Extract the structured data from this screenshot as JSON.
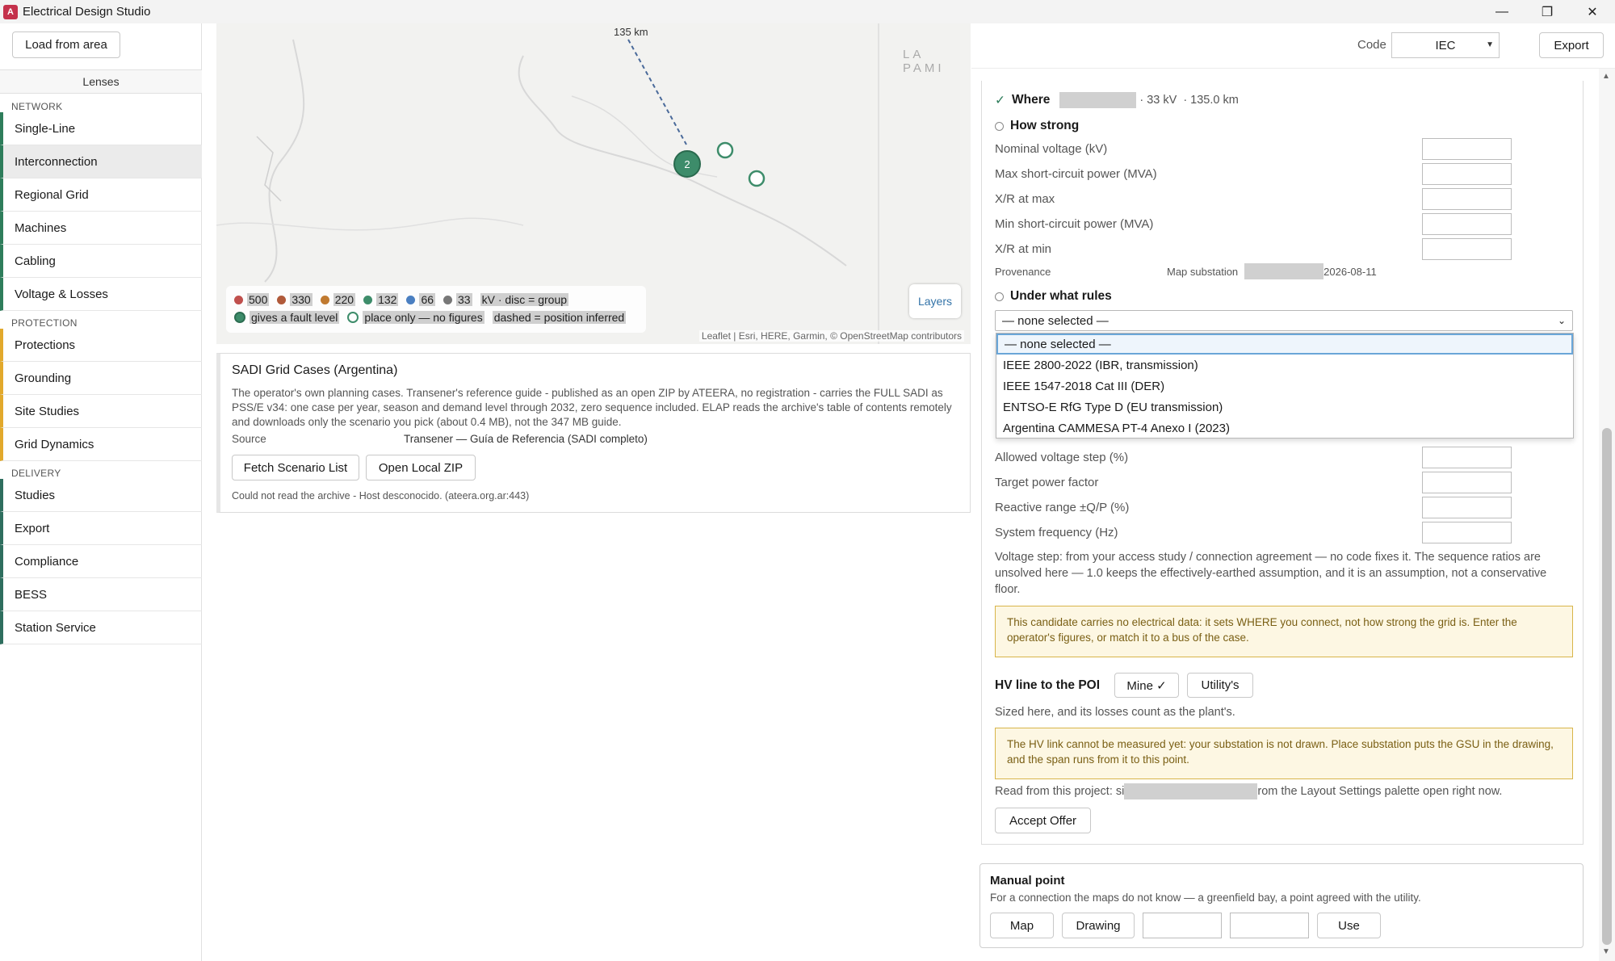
{
  "app": {
    "title": "Electrical Design Studio",
    "icon": "A"
  },
  "window": {
    "minimize": "—",
    "restore": "❐",
    "close": "✕"
  },
  "sidebar": {
    "load_button": "Load from area",
    "lenses_label": "Lenses",
    "groups": [
      {
        "label": "NETWORK",
        "items": [
          "Single-Line",
          "Interconnection",
          "Regional Grid",
          "Machines",
          "Cabling",
          "Voltage & Losses"
        ]
      },
      {
        "label": "PROTECTION",
        "items": [
          "Protections",
          "Grounding",
          "Site Studies",
          "Grid Dynamics"
        ]
      },
      {
        "label": "DELIVERY",
        "items": [
          "Studies",
          "Export",
          "Compliance",
          "BESS",
          "Station Service"
        ]
      }
    ],
    "active_item": "Interconnection"
  },
  "map": {
    "distance_label": "135 km",
    "region_label": "LA PAMI",
    "cluster_count": "2",
    "legend": {
      "voltages": [
        {
          "label": "500",
          "color": "#c0504d"
        },
        {
          "label": "330",
          "color": "#b05a3a"
        },
        {
          "label": "220",
          "color": "#c07a30"
        },
        {
          "label": "132",
          "color": "#3d8c6a"
        },
        {
          "label": "66",
          "color": "#4a7fc1"
        },
        {
          "label": "33",
          "color": "#777777"
        }
      ],
      "unit_note": "kV · disc = group",
      "fault_level": "gives a fault level",
      "place_only": "place only — no figures",
      "dashed": "dashed = position inferred"
    },
    "layers_button": "Layers",
    "attribution": "Leaflet | Esri, HERE, Garmin, © OpenStreetMap contributors"
  },
  "sadi": {
    "title": "SADI Grid Cases (Argentina)",
    "description": "The operator's own planning cases. Transener's reference guide - published as an open ZIP by ATEERA, no registration - carries the FULL SADI as PSS/E v34: one case per year, season and demand level through 2032, zero sequence included. ELAP reads the archive's table of contents remotely and downloads only the scenario you pick (about 0.4 MB), not the 347 MB guide.",
    "source_label": "Source",
    "source_value": "Transener — Guía de Referencia (SADI completo)",
    "fetch_button": "Fetch Scenario List",
    "open_button": "Open Local ZIP",
    "error": "Could not read the archive - Host desconocido. (ateera.org.ar:443)"
  },
  "toolbar": {
    "code_label": "Code",
    "code_value": "IEC",
    "export_button": "Export"
  },
  "where": {
    "label": "Where",
    "voltage": "· 33 kV",
    "distance": "· 135.0 km"
  },
  "how_strong": {
    "label": "How strong",
    "fields": [
      "Nominal voltage (kV)",
      "Max short-circuit power (MVA)",
      "X/R at max",
      "Min short-circuit power (MVA)",
      "X/R at min"
    ],
    "provenance_label": "Provenance",
    "provenance_source": "Map substation",
    "provenance_date": "2026-08-11"
  },
  "rules": {
    "label": "Under what rules",
    "selected": "— none selected —",
    "options": [
      "— none selected —",
      "IEEE 2800-2022 (IBR, transmission)",
      "IEEE 1547-2018 Cat III (DER)",
      "ENTSO-E RfG Type D (EU transmission)",
      "Argentina CAMMESA PT-4 Anexo I (2023)"
    ]
  },
  "rule_fields": [
    "Allowed voltage step (%)",
    "Target power factor",
    "Reactive range ±Q/P (%)",
    "System frequency (Hz)"
  ],
  "voltage_note": "Voltage step: from your access study / connection agreement — no code fixes it. The sequence ratios are unsolved here — 1.0 keeps the effectively-earthed assumption, and it is an assumption, not a conservative floor.",
  "warn_candidate": "This candidate carries no electrical data: it sets WHERE you connect, not how strong the grid is. Enter the operator's figures, or match it to a bus of the case.",
  "hv": {
    "title": "HV line to the POI",
    "mine_button": "Mine ✓",
    "utility_button": "Utility's",
    "sized_note": "Sized here, and its losses count as the plant's.",
    "warn": "The HV link cannot be measured yet: your substation is not drawn. Place substation puts the GSU in the drawing, and the span runs from it to this point.",
    "read_prefix": "Read from this project: si",
    "read_suffix": "rom the Layout Settings palette open right now.",
    "accept_button": "Accept Offer"
  },
  "manual": {
    "title": "Manual point",
    "description": "For a connection the maps do not know — a greenfield bay, a point agreed with the utility.",
    "map_button": "Map",
    "drawing_button": "Drawing",
    "use_button": "Use"
  }
}
